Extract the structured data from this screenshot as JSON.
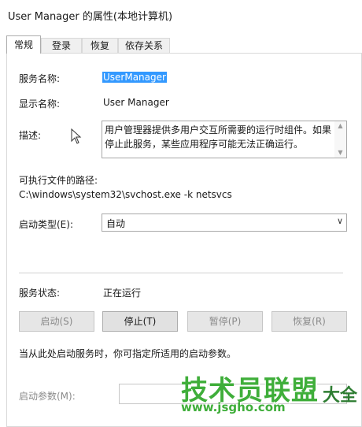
{
  "window": {
    "title": "User Manager 的属性(本地计算机)"
  },
  "tabs": [
    {
      "label": "常规",
      "active": true
    },
    {
      "label": "登录",
      "active": false
    },
    {
      "label": "恢复",
      "active": false
    },
    {
      "label": "依存关系",
      "active": false
    }
  ],
  "general": {
    "service_name_label": "服务名称:",
    "service_name_value": "UserManager",
    "display_name_label": "显示名称:",
    "display_name_value": "User Manager",
    "description_label": "描述:",
    "description_value": "用户管理器提供多用户交互所需要的运行时组件。如果停止此服务，某些应用程序可能无法正确运行。",
    "exe_path_label": "可执行文件的路径:",
    "exe_path_value": "C:\\windows\\system32\\svchost.exe -k netsvcs",
    "startup_type_label": "启动类型(E):",
    "startup_type_value": "自动",
    "service_status_label": "服务状态:",
    "service_status_value": "正在运行",
    "buttons": {
      "start": "启动(S)",
      "stop": "停止(T)",
      "pause": "暂停(P)",
      "resume": "恢复(R)"
    },
    "hint_text": "当从此处启动服务时，你可指定所适用的启动参数。",
    "start_params_label": "启动参数(M):",
    "start_params_value": ""
  },
  "watermark": {
    "big_text": "技术员联盟",
    "url_text": "www.jsgho.com",
    "side_text": "大全"
  },
  "colors": {
    "selection": "#3399ff",
    "watermark_green": "#3fae3a"
  }
}
